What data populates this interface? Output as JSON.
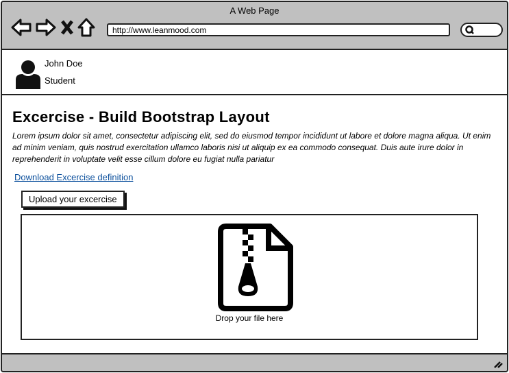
{
  "window": {
    "title": "A Web Page",
    "url": "http://www.leanmood.com"
  },
  "nav_icons": [
    "back-arrow-icon",
    "forward-arrow-icon",
    "close-icon",
    "home-icon",
    "search-icon"
  ],
  "user": {
    "name": "John Doe",
    "role": "Student"
  },
  "main": {
    "title": "Excercise - Build Bootstrap Layout",
    "description": "Lorem ipsum dolor sit amet, consectetur adipiscing elit, sed do eiusmod tempor incididunt ut labore et dolore magna aliqua. Ut enim ad minim veniam, quis nostrud exercitation ullamco laboris nisi ut aliquip ex ea commodo consequat. Duis aute irure dolor in reprehenderit in voluptate velit esse cillum dolore eu fugiat nulla pariatur",
    "download_link": "Download Excercise definition",
    "upload_button": "Upload your excercise",
    "dropzone_label": "Drop your file here"
  },
  "colors": {
    "chrome": "#c0c0c0",
    "link": "#0b4f9c"
  }
}
